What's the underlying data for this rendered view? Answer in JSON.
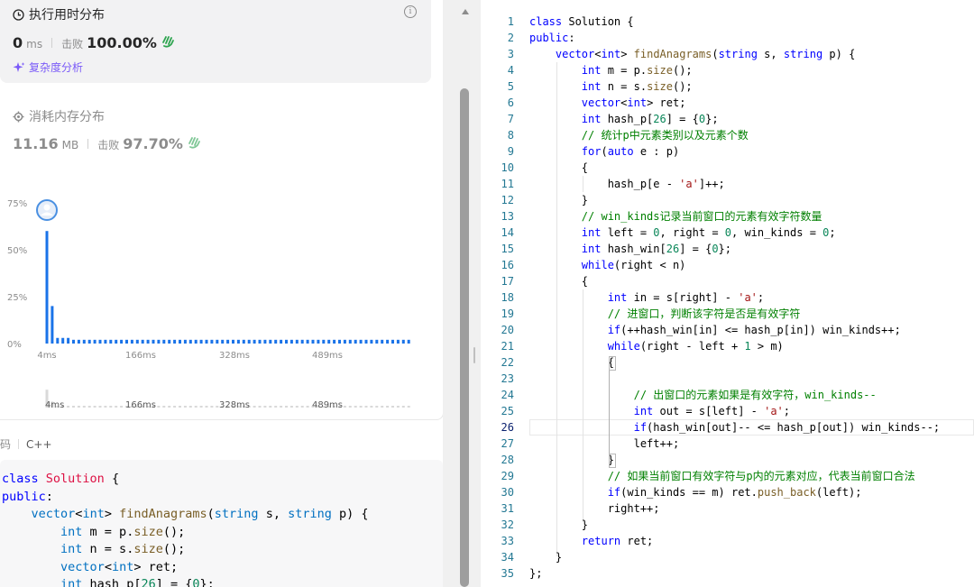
{
  "runtime": {
    "title": "执行用时分布",
    "value": "0",
    "unit": "ms",
    "beats_label": "击败",
    "beats_value": "100.00%",
    "analysis_label": "复杂度分析"
  },
  "memory": {
    "title": "消耗内存分布",
    "value": "11.16",
    "unit": "MB",
    "beats_label": "击败",
    "beats_value": "97.70%"
  },
  "chart_data": {
    "type": "bar",
    "x_ticks": [
      "4ms",
      "166ms",
      "328ms",
      "489ms"
    ],
    "y_ticks": [
      "75%",
      "50%",
      "25%",
      "0%"
    ],
    "ylim": [
      0,
      75
    ],
    "values": [
      60,
      20,
      3,
      3,
      3,
      2,
      2,
      2,
      2,
      2,
      2,
      2,
      2,
      2,
      2,
      2,
      2,
      2,
      2,
      2,
      2,
      2,
      2,
      2,
      2,
      2,
      2,
      2,
      2,
      2,
      2,
      2,
      2,
      2,
      2,
      2,
      2,
      2,
      2,
      2,
      2,
      2,
      2,
      2,
      2,
      2,
      2,
      2,
      2,
      2,
      2,
      2,
      2,
      2,
      2,
      2,
      2,
      2,
      2,
      2,
      2,
      2,
      2,
      2,
      2,
      2,
      2,
      2,
      2
    ],
    "bar_color": "#1a73e8"
  },
  "overview_ticks": [
    "4ms",
    "166ms",
    "328ms",
    "489ms"
  ],
  "code_section": {
    "label": "码",
    "language": "C++",
    "preview_lines": [
      "class Solution {",
      "public:",
      "    vector<int> findAnagrams(string s, string p) {",
      "        int m = p.size();",
      "        int n = s.size();",
      "        vector<int> ret;",
      "        int hash_p[26] = {0};"
    ]
  },
  "editor": {
    "active_line": 26,
    "lines": [
      "class Solution {",
      "public:",
      "    vector<int> findAnagrams(string s, string p) {",
      "        int m = p.size();",
      "        int n = s.size();",
      "        vector<int> ret;",
      "        int hash_p[26] = {0};",
      "        // 统计p中元素类别以及元素个数",
      "        for(auto e : p)",
      "        {",
      "            hash_p[e - 'a']++;",
      "        }",
      "        // win_kinds记录当前窗口的元素有效字符数量",
      "        int left = 0, right = 0, win_kinds = 0;",
      "        int hash_win[26] = {0};",
      "        while(right < n)",
      "        {",
      "            int in = s[right] - 'a';",
      "            // 进窗口，判断该字符是否是有效字符",
      "            if(++hash_win[in] <= hash_p[in]) win_kinds++;",
      "            while(right - left + 1 > m)",
      "            {",
      "",
      "                // 出窗口的元素如果是有效字符，win_kinds--",
      "                int out = s[left] - 'a';",
      "                if(hash_win[out]-- <= hash_p[out]) win_kinds--;",
      "                left++;",
      "            }",
      "            // 如果当前窗口有效字符与p内的元素对应，代表当前窗口合法",
      "            if(win_kinds == m) ret.push_back(left);",
      "            right++;",
      "        }",
      "        return ret;",
      "    }",
      "};"
    ]
  }
}
